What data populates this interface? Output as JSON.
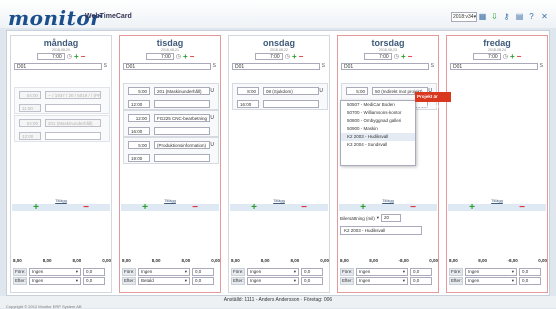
{
  "header": {
    "logo_text": "monitor",
    "app_name": "WebTimeCard",
    "week": "2018:v34",
    "icons": [
      "calendar-icon",
      "download-icon",
      "key-icon",
      "print-icon",
      "help-icon",
      "close-icon"
    ]
  },
  "days": [
    {
      "name": "måndag",
      "date": "2018-08-20",
      "time": "7:00",
      "project": "D01",
      "s": "S",
      "blocks": [
        {
          "start": "04:00",
          "end": "11:00",
          "activity": "-- / 1937 / 20 / 5019 / / (PP",
          "disabled": true,
          "u": ""
        },
        {
          "start": "04:00",
          "end": "12:00",
          "activity": "201 (Maskinunderhåll)",
          "disabled": true,
          "u": ""
        }
      ],
      "total": "Tillägg",
      "sums": [
        "8,00",
        "8,00",
        "8,00",
        "0,00"
      ],
      "fore_label": "Före:",
      "fore_sel": "Ingen",
      "fore_val": "0,0",
      "efter_label": "Efter:",
      "efter_sel": "Ingen",
      "efter_val": "0,0"
    },
    {
      "name": "tisdag",
      "date": "2018-08-21",
      "time": "7:00",
      "project": "D01",
      "s": "S",
      "blocks": [
        {
          "start": "5:00",
          "end": "12:00",
          "activity": "201 (Maskinunderhåll)",
          "disabled": false,
          "u": "U"
        },
        {
          "start": "12:00",
          "end": "16:00",
          "activity": "FG225 CNC-bearbetning",
          "disabled": false,
          "u": "U"
        },
        {
          "start": "5:00",
          "end": "19:00",
          "activity": "(Produktionsinformation)",
          "disabled": false,
          "u": "U"
        }
      ],
      "total": "Tillägg",
      "sums": [
        "8,00",
        "8,00",
        "8,00",
        "0,00"
      ],
      "fore_label": "Före:",
      "fore_sel": "Ingen",
      "fore_val": "0,0",
      "efter_label": "Efter:",
      "efter_sel": "Betald",
      "efter_val": "0,0"
    },
    {
      "name": "onsdag",
      "date": "2018-08-22",
      "time": "7:00",
      "project": "D01",
      "s": "S",
      "blocks": [
        {
          "start": "8:00",
          "end": "16:00",
          "activity": "08 (Sjukdom)",
          "disabled": false,
          "u": "U"
        }
      ],
      "total": "Tillägg",
      "sums": [
        "8,00",
        "8,00",
        "8,00",
        "0,00"
      ],
      "fore_label": "Före:",
      "fore_sel": "Ingen",
      "fore_val": "0,0",
      "efter_label": "Efter:",
      "efter_sel": "Ingen",
      "efter_val": "0,0"
    },
    {
      "name": "torsdag",
      "date": "2018-08-23",
      "time": "7:00",
      "project": "D01",
      "s": "S",
      "blocks": [
        {
          "start": "5:00",
          "end": "7:00",
          "activity": "50 (Indirekt mot projekt)",
          "disabled": false,
          "u": "U"
        }
      ],
      "total": "Tillägg",
      "sums": [
        "8,00",
        "8,00",
        "-8,00",
        "0,00"
      ],
      "fore_label": "Före:",
      "fore_sel": "Ingen",
      "fore_val": "0,0",
      "efter_label": "Efter:",
      "efter_sel": "Ingen",
      "efter_val": "0,0"
    },
    {
      "name": "fredag",
      "date": "2018-08-24",
      "time": "7:00",
      "project": "D01",
      "s": "S",
      "blocks": [],
      "total": "Tillägg",
      "sums": [
        "8,00",
        "8,00",
        "-8,00",
        "0,00"
      ],
      "fore_label": "Före:",
      "fore_sel": "Ingen",
      "fore_val": "0,0",
      "efter_label": "Efter:",
      "efter_sel": "Ingen",
      "efter_val": "0,0"
    }
  ],
  "dropdown": {
    "options": [
      "50507 - MediCar Boden",
      "50700 - Williamsons-kontor",
      "50800 - Ombyggnad galleri",
      "50900 - Maskin",
      "K2 2003 - Hudiksvall",
      "K3 2004 - Sundsvall"
    ],
    "highlighted": 4
  },
  "tooltip": "Projekt är inregistrerat!",
  "billing": {
    "label": "Bilersättning (mil)",
    "val": "20",
    "project": "K2 2003 - Hudiksvall"
  },
  "footer": {
    "user": "Anställd: 1111 - Anders Andersson · Företag: 006",
    "copyright": "Copyright © 2012 Monitor ERP System AB"
  }
}
